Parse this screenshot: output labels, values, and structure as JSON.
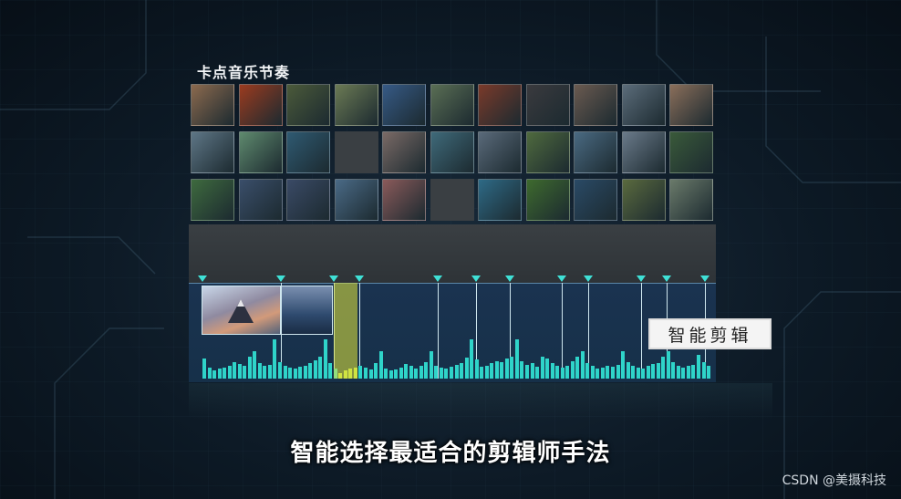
{
  "panel": {
    "title": "卡点音乐节奏"
  },
  "thumbnails": {
    "rows": [
      [
        "#8c6a4e",
        "#9b3b1f",
        "#4b5a3a",
        "#6b7a54",
        "#365a86",
        "#5a6e54",
        "#7a3a2a",
        "#3a3a3e",
        "#6a5a50",
        "#5b6c7a",
        "#8a6e5a"
      ],
      [
        "#5e7686",
        "#5f8a6e",
        "#2f5a72",
        "",
        "#7a6a66",
        "#3f6a7a",
        "#5a6a7a",
        "#4f6a3e",
        "#4a6a82",
        "#6a7a8a",
        "#3a5a3a"
      ],
      [
        "#3e6a3e",
        "#3a4e6a",
        "#3a4a66",
        "#4a6a86",
        "#8a5a5a",
        "",
        "#2e6a86",
        "#3e6a2e",
        "#2a4a66",
        "#5a6a3e",
        "#6a7a6a"
      ]
    ]
  },
  "timeline": {
    "marker_color": "#3fe0d6",
    "bar_color": "#2fd4c9",
    "highlight_color": "#e2e63c",
    "bar_levels": [
      0.45,
      0.25,
      0.18,
      0.22,
      0.25,
      0.3,
      0.38,
      0.34,
      0.3,
      0.5,
      0.62,
      0.35,
      0.3,
      0.32,
      0.9,
      0.38,
      0.3,
      0.26,
      0.22,
      0.28,
      0.3,
      0.35,
      0.42,
      0.5,
      0.9,
      0.36,
      0.22,
      0.12,
      0.18,
      0.22,
      0.26,
      0.3,
      0.25,
      0.2,
      0.35,
      0.62,
      0.22,
      0.18,
      0.2,
      0.26,
      0.34,
      0.3,
      0.22,
      0.3,
      0.38,
      0.62,
      0.3,
      0.26,
      0.22,
      0.28,
      0.32,
      0.36,
      0.48,
      0.9,
      0.44,
      0.28,
      0.3,
      0.36,
      0.4,
      0.38,
      0.46,
      0.5,
      0.9,
      0.4,
      0.32,
      0.35,
      0.28,
      0.5,
      0.46,
      0.36,
      0.3,
      0.26,
      0.3,
      0.4,
      0.5,
      0.62,
      0.36,
      0.3,
      0.24,
      0.26,
      0.3,
      0.28,
      0.32,
      0.62,
      0.38,
      0.3,
      0.26,
      0.24,
      0.3,
      0.34,
      0.35,
      0.5,
      0.62,
      0.38,
      0.3,
      0.25,
      0.3,
      0.32,
      0.55,
      0.38,
      0.3
    ],
    "label": "智能剪辑"
  },
  "subtitle": "智能选择最适合的剪辑师手法",
  "watermark": "CSDN @美摄科技"
}
